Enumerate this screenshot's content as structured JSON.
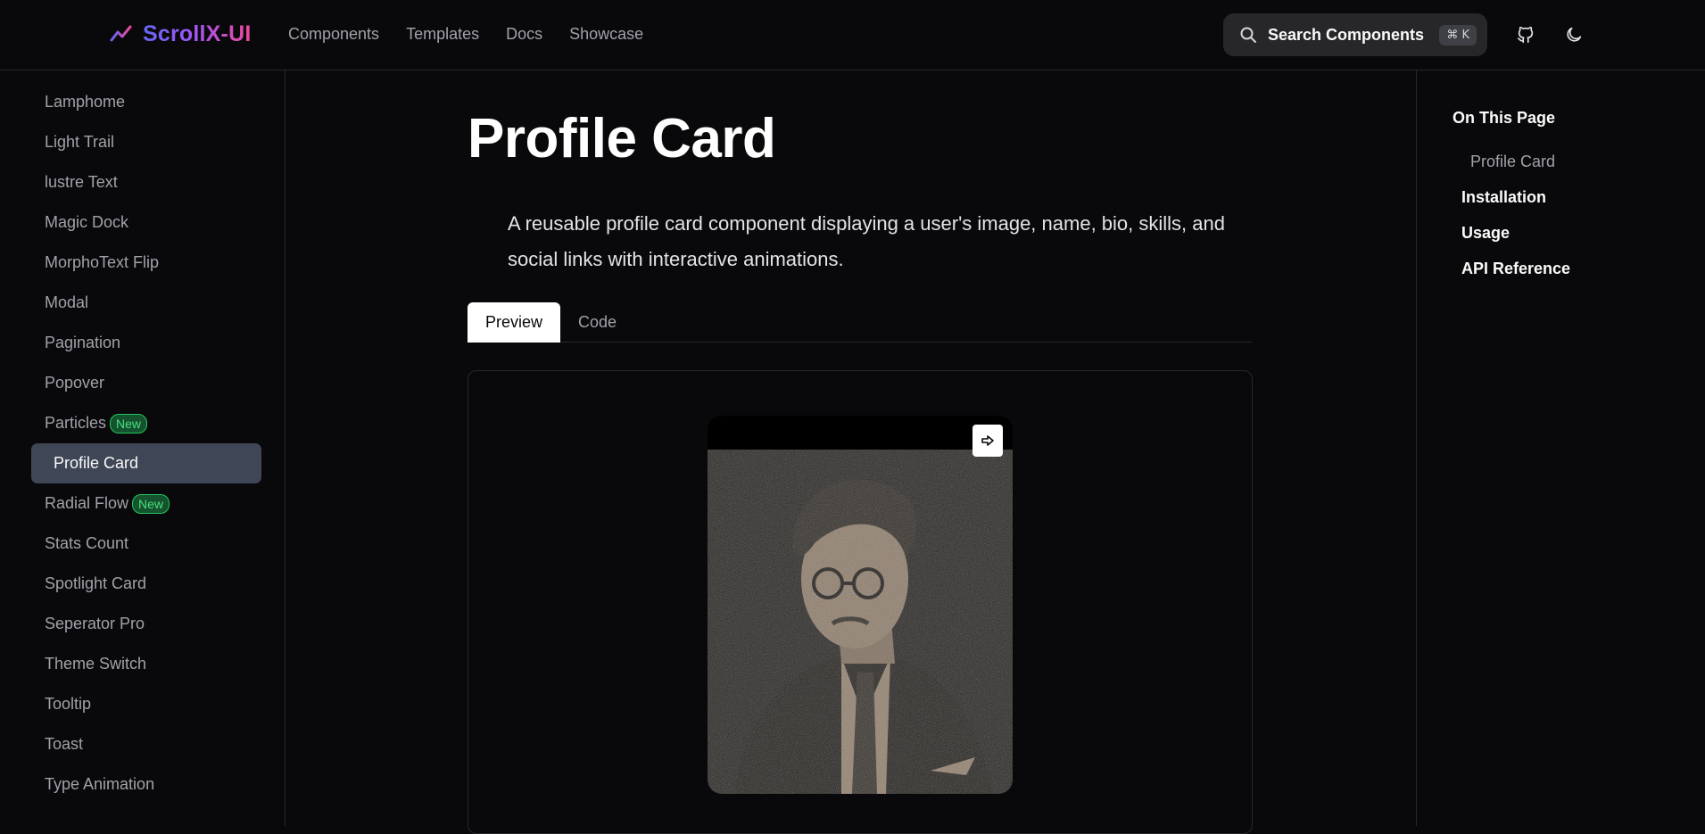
{
  "brand": {
    "name": "ScrollX-UI",
    "gradient": [
      "#6366f1",
      "#a855f7",
      "#ec4899"
    ]
  },
  "nav": [
    "Components",
    "Templates",
    "Docs",
    "Showcase"
  ],
  "search": {
    "label": "Search Components",
    "shortcut": "⌘ K"
  },
  "header_icons": [
    "github-icon",
    "moon-icon"
  ],
  "sidebar": {
    "items": [
      {
        "label": "Lamphome"
      },
      {
        "label": "Light Trail"
      },
      {
        "label": "lustre Text"
      },
      {
        "label": "Magic Dock"
      },
      {
        "label": "MorphoText Flip"
      },
      {
        "label": "Modal"
      },
      {
        "label": "Pagination"
      },
      {
        "label": "Popover"
      },
      {
        "label": "Particles",
        "badge": "New"
      },
      {
        "label": "Profile Card",
        "active": true
      },
      {
        "label": "Radial Flow",
        "badge": "New"
      },
      {
        "label": "Stats Count"
      },
      {
        "label": "Spotlight Card"
      },
      {
        "label": "Seperator Pro"
      },
      {
        "label": "Theme Switch"
      },
      {
        "label": "Tooltip"
      },
      {
        "label": "Toast"
      },
      {
        "label": "Type Animation"
      }
    ]
  },
  "main": {
    "title": "Profile Card",
    "description": "A reusable profile card component displaying a user's image, name, bio, skills, and social links with interactive animations.",
    "tabs": [
      {
        "label": "Preview",
        "active": true
      },
      {
        "label": "Code"
      }
    ]
  },
  "toc": {
    "title": "On This Page",
    "items": [
      "Profile Card",
      "Installation",
      "Usage",
      "API Reference"
    ]
  }
}
